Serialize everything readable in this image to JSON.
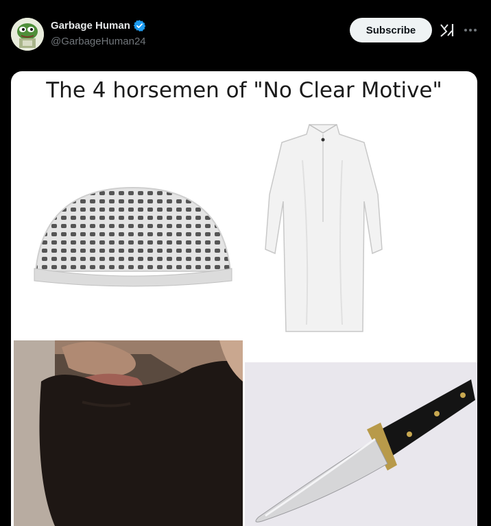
{
  "post": {
    "author": {
      "display_name": "Garbage Human",
      "handle": "@GarbageHuman24",
      "verified": true
    },
    "actions": {
      "subscribe_label": "Subscribe",
      "grok_icon": "grok-icon",
      "more_icon": "more-icon"
    }
  },
  "meme": {
    "title": "The 4 horsemen of \"No Clear Motive\"",
    "panels": [
      "kufi-cap",
      "white-thobe",
      "beard",
      "knife"
    ]
  },
  "colors": {
    "background": "#000000",
    "verified_badge": "#1d9bf0",
    "subscribe_bg": "#eff3f4",
    "handle_text": "#71767b"
  }
}
